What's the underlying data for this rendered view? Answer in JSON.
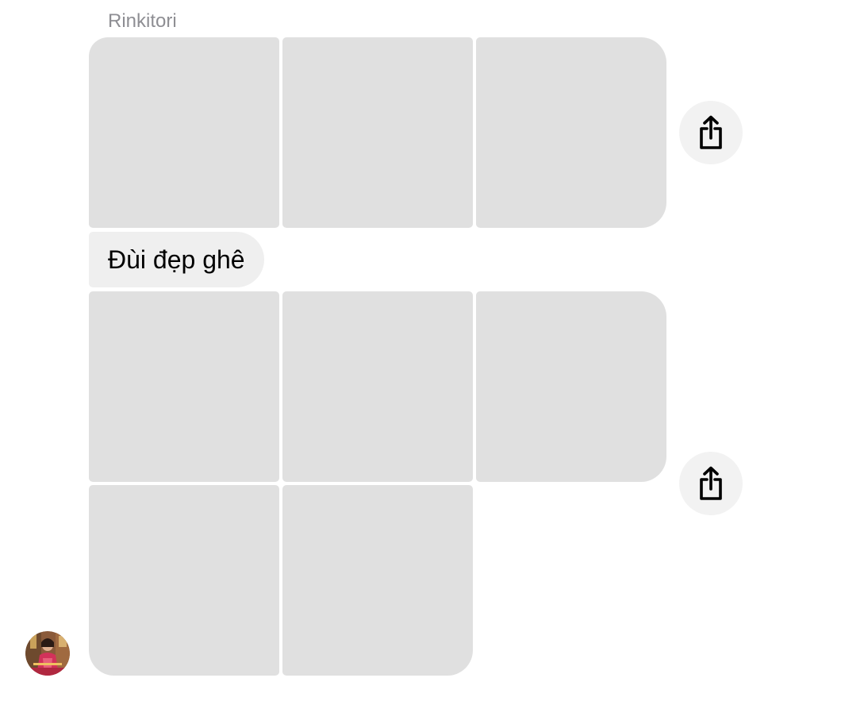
{
  "thread": {
    "sender_name": "Rinkitori",
    "text_message": "Đùi đẹp ghê"
  },
  "icons": {
    "share": "share-icon",
    "avatar": "avatar"
  },
  "colors": {
    "background": "#ffffff",
    "photo_placeholder": "#e0e0e0",
    "bubble_background": "#efefef",
    "share_button_background": "#f2f2f2",
    "sender_name_color": "#8e8e93",
    "message_text_color": "#000000"
  }
}
